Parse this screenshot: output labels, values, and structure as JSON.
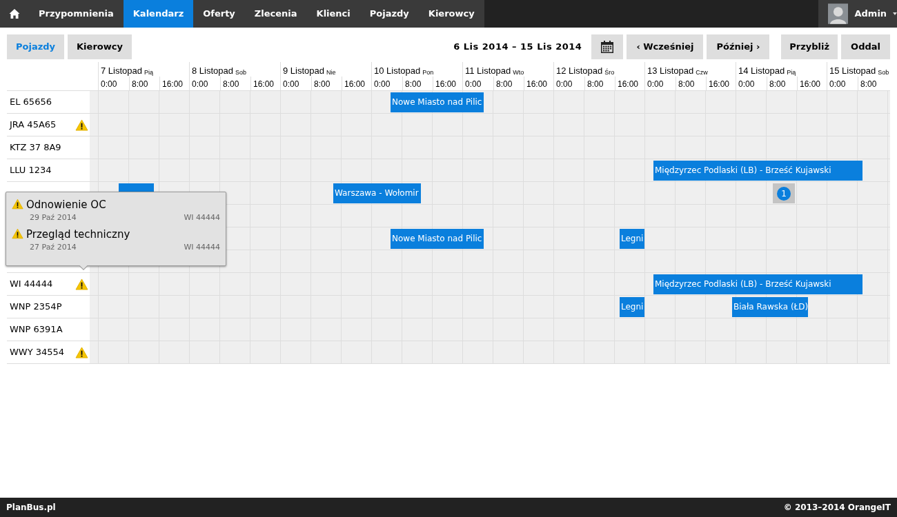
{
  "nav": {
    "items": [
      {
        "label": "Przypomnienia",
        "selected": false
      },
      {
        "label": "Kalendarz",
        "selected": true
      },
      {
        "label": "Oferty",
        "selected": false
      },
      {
        "label": "Zlecenia",
        "selected": false
      },
      {
        "label": "Klienci",
        "selected": false
      },
      {
        "label": "Pojazdy",
        "selected": false
      },
      {
        "label": "Kierowcy",
        "selected": false
      }
    ],
    "user": "Admin"
  },
  "toolbar": {
    "views": [
      {
        "label": "Pojazdy",
        "selected": true
      },
      {
        "label": "Kierowcy",
        "selected": false
      }
    ],
    "range": "6 Lis 2014 – 15 Lis 2014",
    "earlier": "‹ Wcześniej",
    "later": "Później ›",
    "zoom_in": "Przybliż",
    "zoom_out": "Oddal"
  },
  "days": [
    {
      "date": "7 Listopad",
      "weekday": "Pią",
      "hours": [
        "0:00",
        "8:00",
        "16:00"
      ]
    },
    {
      "date": "8 Listopad",
      "weekday": "Sob",
      "hours": [
        "0:00",
        "8:00",
        "16:00"
      ]
    },
    {
      "date": "9 Listopad",
      "weekday": "Nie",
      "hours": [
        "0:00",
        "8:00",
        "16:00"
      ]
    },
    {
      "date": "10 Listopad",
      "weekday": "Pon",
      "hours": [
        "0:00",
        "8:00",
        "16:00"
      ]
    },
    {
      "date": "11 Listopad",
      "weekday": "Wto",
      "hours": [
        "0:00",
        "8:00",
        "16:00"
      ]
    },
    {
      "date": "12 Listopad",
      "weekday": "Śro",
      "hours": [
        "0:00",
        "8:00",
        "16:00"
      ]
    },
    {
      "date": "13 Listopad",
      "weekday": "Czw",
      "hours": [
        "0:00",
        "8:00",
        "16:00"
      ]
    },
    {
      "date": "14 Listopad",
      "weekday": "Pią",
      "hours": [
        "0:00",
        "8:00",
        "16:00"
      ]
    },
    {
      "date": "15 Listopad",
      "weekday": "Sob",
      "hours": [
        "0:00",
        "8:00"
      ]
    }
  ],
  "rows": [
    {
      "label": "EL 65656",
      "warning": false,
      "events": [
        {
          "kind": "trip",
          "text": "Nowe Miasto nad Pilic"
        }
      ]
    },
    {
      "label": "JRA 45A65",
      "warning": true,
      "events": []
    },
    {
      "label": "KTZ 37 8A9",
      "warning": false,
      "events": []
    },
    {
      "label": "LLU 1234",
      "warning": false,
      "events": [
        {
          "kind": "trip",
          "text": "Międzyrzec Podlaski (LB) - Brześć Kujawski"
        }
      ]
    },
    {
      "events": [
        {
          "kind": "trip"
        },
        {
          "kind": "trip",
          "text": "Warszawa - Wołomir"
        },
        {
          "kind": "count",
          "text": "1"
        }
      ]
    },
    {
      "events": []
    },
    {
      "events": [
        {
          "kind": "trip",
          "text": "Nowe Miasto nad Pilic"
        },
        {
          "kind": "trip",
          "text": "Legni"
        }
      ]
    },
    {
      "events": []
    },
    {
      "label": "WI 44444",
      "warning": true,
      "events": [
        {
          "kind": "trip",
          "text": "Międzyrzec Podlaski (LB) - Brześć Kujawski"
        }
      ]
    },
    {
      "label": "WNP 2354P",
      "warning": false,
      "events": [
        {
          "kind": "trip",
          "text": "Legni"
        },
        {
          "kind": "trip",
          "text": "Biała Rawska (ŁD)"
        }
      ]
    },
    {
      "label": "WNP 6391A",
      "warning": false,
      "events": []
    },
    {
      "label": "WWY 34554",
      "warning": true,
      "events": []
    }
  ],
  "popover": {
    "items": [
      {
        "title": "Odnowienie OC",
        "date": "29 Paź 2014",
        "plate": "WI 44444"
      },
      {
        "title": "Przegląd techniczny",
        "date": "27 Paź 2014",
        "plate": "WI 44444"
      }
    ]
  },
  "footer": {
    "left": "PlanBus.pl",
    "right": "© 2013–2014 OrangeIT"
  }
}
